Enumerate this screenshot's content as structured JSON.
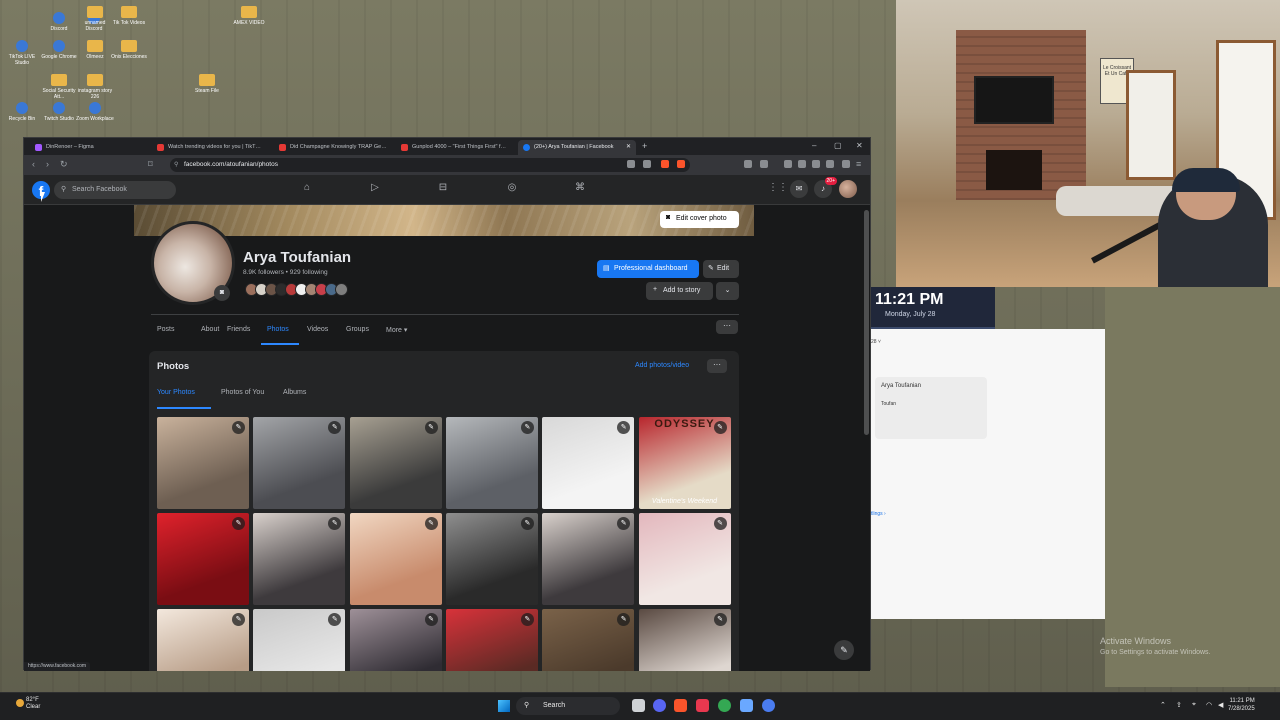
{
  "desktop": {
    "icons": [
      {
        "label": "Discord",
        "type": "app"
      },
      {
        "label": "Discord",
        "type": "app"
      },
      {
        "label": "unnamed",
        "type": "folder"
      },
      {
        "label": "Tik Tok Videos",
        "type": "folder"
      },
      {
        "label": "AMEX VIDEO",
        "type": "folder"
      },
      {
        "label": "TikTok LIVE Studio",
        "type": "app"
      },
      {
        "label": "Google Chrome",
        "type": "app"
      },
      {
        "label": "Olmeez",
        "type": "folder"
      },
      {
        "label": "Onix Elecciones",
        "type": "folder"
      },
      {
        "label": "Social Security Att...",
        "type": "folder"
      },
      {
        "label": "instagram story 226",
        "type": "folder"
      },
      {
        "label": "Recycle Bin",
        "type": "app"
      },
      {
        "label": "Twitch Studio",
        "type": "app"
      },
      {
        "label": "Zoom Workplace",
        "type": "app"
      },
      {
        "label": "Steam File",
        "type": "folder"
      }
    ],
    "watermark_title": "Activate Windows",
    "watermark_sub": "Go to Settings to activate Windows."
  },
  "webcam": {
    "poster_text": "Le Croissant Et Un Cafe"
  },
  "side_app": {
    "clock_time": "11:21 PM",
    "clock_date": "Monday, July 28",
    "dropdown": "28 ˅",
    "contact_name": "Arya Toufanian",
    "contact_sub": "Toufan",
    "link": "tlings ›"
  },
  "browser": {
    "tabs": [
      {
        "title": "DinRenoer – Figma",
        "kind": "figma"
      },
      {
        "title": "Watch trending videos for you | TikT…",
        "kind": "tiktok"
      },
      {
        "title": "Did Champagne Knowingly TRAP Ge…",
        "kind": "youtube"
      },
      {
        "title": "Gunplod 4000 – \"First Things First\" f…",
        "kind": "youtube"
      },
      {
        "title": "(20+) Arya Toufanian | Facebook",
        "kind": "facebook",
        "active": true
      }
    ],
    "new_tab": "+",
    "url": "facebook.com/atoufanian/photos",
    "status_url": "https://www.facebook.com"
  },
  "fb": {
    "search_placeholder": "Search Facebook",
    "messenger_badge": "",
    "notif_badge": "20+",
    "cover_button": "Edit cover photo",
    "profile_name": "Arya Toufanian",
    "profile_stats": "8.9K followers • 929 following",
    "pro_dashboard": "Professional dashboard",
    "edit": "Edit",
    "add_story": "Add to story",
    "tabs": [
      "Posts",
      "About",
      "Friends",
      "Photos",
      "Videos",
      "Groups",
      "More"
    ],
    "active_tab": "Photos",
    "photos_title": "Photos",
    "add_photos": "Add photos/video",
    "subtabs": [
      "Your Photos",
      "Photos of You",
      "Albums"
    ],
    "photos": [
      {
        "desc": "cat",
        "c1": "#6e5f52",
        "c2": "#c9b29c"
      },
      {
        "desc": "city rooftop",
        "c1": "#4c4d52",
        "c2": "#a3a5a8"
      },
      {
        "desc": "balcony",
        "c1": "#3b3b3b",
        "c2": "#a7a092"
      },
      {
        "desc": "building",
        "c1": "#5d6066",
        "c2": "#b5b8bb"
      },
      {
        "desc": "bunny costume",
        "c1": "#f4f4f4",
        "c2": "#d8d8d8"
      },
      {
        "desc": "magazine cover",
        "c1": "#e5dbc7",
        "c2": "#b8262d",
        "header": "ODYSSEY",
        "caption": "Valentine's Weekend"
      },
      {
        "desc": "red room",
        "c1": "#7a0d13",
        "c2": "#e0222c"
      },
      {
        "desc": "dinner table",
        "c1": "#3e3a3d",
        "c2": "#d9d1cc"
      },
      {
        "desc": "party table",
        "c1": "#c88b6c",
        "c2": "#f1d7c2"
      },
      {
        "desc": "legs",
        "c1": "#2a2a2a",
        "c2": "#8f8f8f"
      },
      {
        "desc": "dinner table 2",
        "c1": "#3e3a3d",
        "c2": "#d9d1cc"
      },
      {
        "desc": "mirror selfie",
        "c1": "#f1e7e4",
        "c2": "#e3b7bd"
      },
      {
        "desc": "dinner",
        "c1": "#b79c86",
        "c2": "#f3e8dd"
      },
      {
        "desc": "i love nyc",
        "c1": "#e7e7e7",
        "c2": "#c9c9c9"
      },
      {
        "desc": "table night",
        "c1": "#2f2c33",
        "c2": "#9e9098"
      },
      {
        "desc": "christmas party",
        "c1": "#5a2a24",
        "c2": "#d8323a"
      },
      {
        "desc": "wood",
        "c1": "#4b3a2b",
        "c2": "#7a6249"
      },
      {
        "desc": "friends",
        "c1": "#ded6d0",
        "c2": "#5a4a42"
      }
    ]
  },
  "taskbar": {
    "weather_temp": "82°F",
    "weather_desc": "Clear",
    "search": "Search",
    "time": "11:21 PM",
    "date": "7/28/2025"
  }
}
